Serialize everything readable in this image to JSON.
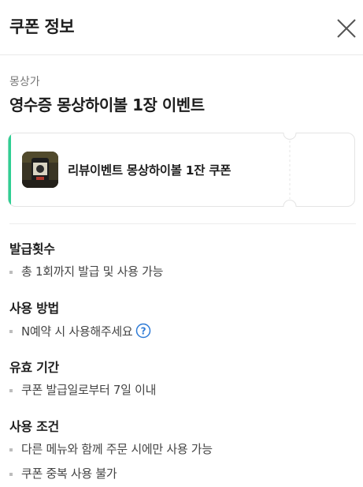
{
  "header": {
    "title": "쿠폰 정보",
    "close_icon": "close-icon"
  },
  "store": {
    "name": "몽상가",
    "event_title": "영수증 몽상하이볼 1장 이벤트"
  },
  "coupon": {
    "name": "리뷰이벤트 몽상하이볼 1잔 쿠폰",
    "accent_color": "#2fcf93",
    "thumbnail_icon": "drink-thumbnail"
  },
  "sections": {
    "issue": {
      "title": "발급횟수",
      "items": [
        "총 1회까지 발급 및 사용 가능"
      ]
    },
    "usage": {
      "title": "사용 방법",
      "items": [
        "N예약 시 사용해주세요"
      ],
      "help_icon": "question-circle-icon",
      "help_color": "#2e7bd6"
    },
    "validity": {
      "title": "유효 기간",
      "items": [
        "쿠폰 발급일로부터 7일 이내"
      ]
    },
    "conditions": {
      "title": "사용 조건",
      "items": [
        "다른 메뉴와 함께 주문 시에만 사용 가능",
        "쿠폰 중복 사용 불가"
      ]
    }
  }
}
